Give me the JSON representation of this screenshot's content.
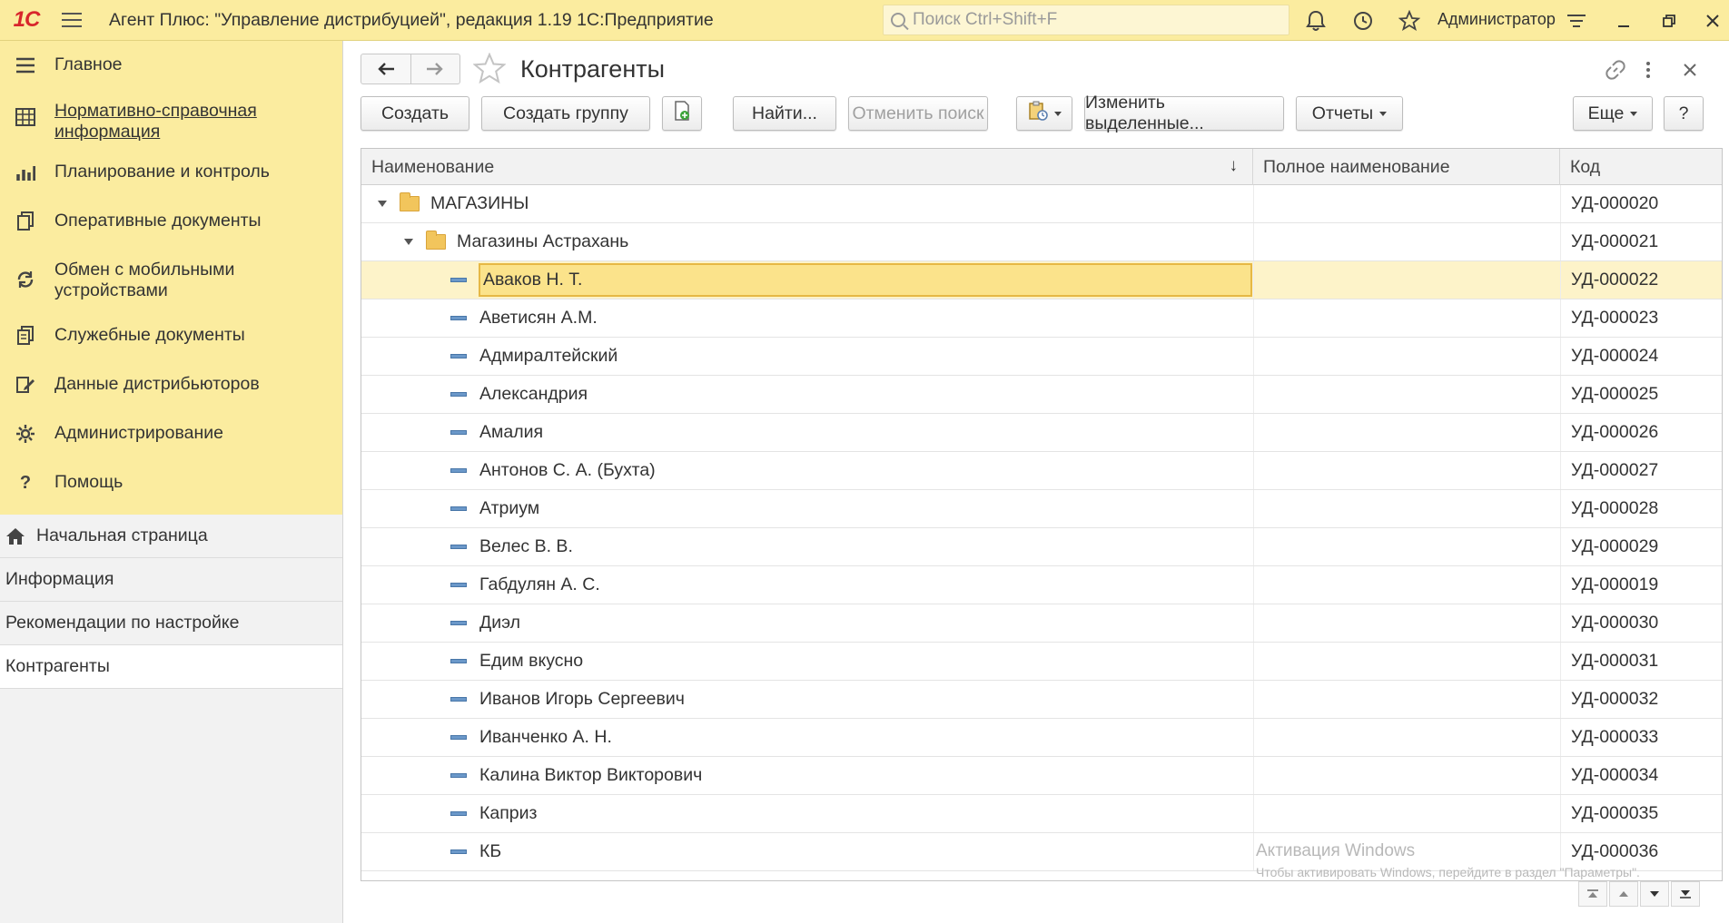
{
  "app": {
    "logo": "1С",
    "title": "Агент Плюс: \"Управление дистрибуцией\", редакция 1.19 1С:Предприятие",
    "search_placeholder": "Поиск Ctrl+Shift+F",
    "user": "Администратор"
  },
  "sidebar": {
    "sections": [
      {
        "label": "Главное",
        "icon": "menu-icon"
      },
      {
        "label": "Нормативно-справочная информация",
        "icon": "grid-icon"
      },
      {
        "label": "Планирование и контроль",
        "icon": "bar-chart-icon"
      },
      {
        "label": "Оперативные документы",
        "icon": "documents-icon"
      },
      {
        "label": "Обмен с мобильными устройствами",
        "icon": "sync-icon"
      },
      {
        "label": "Служебные документы",
        "icon": "service-docs-icon"
      },
      {
        "label": "Данные дистрибьюторов",
        "icon": "distributor-icon"
      },
      {
        "label": "Администрирование",
        "icon": "gear-icon"
      },
      {
        "label": "Помощь",
        "icon": "question-icon"
      }
    ],
    "open_windows": [
      {
        "label": "Начальная страница"
      },
      {
        "label": "Информация"
      },
      {
        "label": "Рекомендации по настройке"
      },
      {
        "label": "Контрагенты"
      }
    ]
  },
  "form": {
    "title": "Контрагенты",
    "toolbar": {
      "create": "Создать",
      "create_group": "Создать группу",
      "find": "Найти...",
      "cancel_search": "Отменить поиск",
      "change_selected": "Изменить выделенные...",
      "reports": "Отчеты",
      "more": "Еще",
      "help": "?"
    },
    "columns": {
      "name": "Наименование",
      "full_name": "Полное наименование",
      "code": "Код"
    },
    "rows": [
      {
        "name": "МАГАЗИНЫ",
        "full_name": "",
        "code": "УД-000020"
      },
      {
        "name": "Магазины Астрахань",
        "full_name": "",
        "code": "УД-000021"
      },
      {
        "name": "Аваков Н. Т.",
        "full_name": "",
        "code": "УД-000022"
      },
      {
        "name": "Аветисян А.М.",
        "full_name": "",
        "code": "УД-000023"
      },
      {
        "name": "Адмиралтейский",
        "full_name": "",
        "code": "УД-000024"
      },
      {
        "name": "Александрия",
        "full_name": "",
        "code": "УД-000025"
      },
      {
        "name": "Амалия",
        "full_name": "",
        "code": "УД-000026"
      },
      {
        "name": "Антонов С. А. (Бухта)",
        "full_name": "",
        "code": "УД-000027"
      },
      {
        "name": "Атриум",
        "full_name": "",
        "code": "УД-000028"
      },
      {
        "name": "Велес В. В.",
        "full_name": "",
        "code": "УД-000029"
      },
      {
        "name": "Габдулян А. С.",
        "full_name": "",
        "code": "УД-000019"
      },
      {
        "name": "Диэл",
        "full_name": "",
        "code": "УД-000030"
      },
      {
        "name": "Едим вкусно",
        "full_name": "",
        "code": "УД-000031"
      },
      {
        "name": "Иванов Игорь Сергеевич",
        "full_name": "",
        "code": "УД-000032"
      },
      {
        "name": "Иванченко А. Н.",
        "full_name": "",
        "code": "УД-000033"
      },
      {
        "name": "Калина Виктор Викторович",
        "full_name": "",
        "code": "УД-000034"
      },
      {
        "name": "Каприз",
        "full_name": "",
        "code": "УД-000035"
      },
      {
        "name": "КБ",
        "full_name": "",
        "code": "УД-000036"
      }
    ]
  },
  "watermark": {
    "line1": "Активация Windows",
    "line2": "Чтобы активировать Windows, перейдите в раздел \"Параметры\"."
  }
}
